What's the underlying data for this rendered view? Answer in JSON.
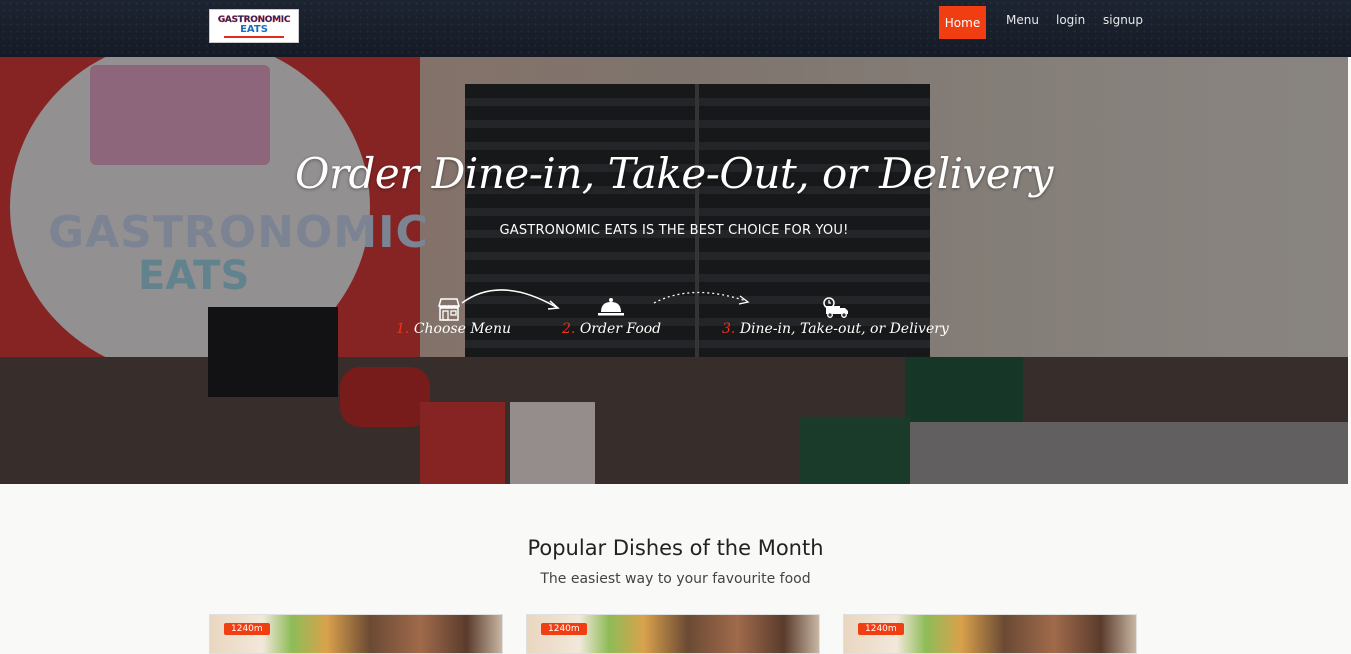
{
  "navbar": {
    "logo": {
      "line1": "GASTRONOMIC",
      "line2": "EATS"
    },
    "links": [
      {
        "label": "Home",
        "active": true
      },
      {
        "label": "Menu"
      },
      {
        "label": "login"
      },
      {
        "label": "signup"
      }
    ],
    "active_color": "#f03d11"
  },
  "hero": {
    "title": "Order Dine-in, Take-Out, or Delivery",
    "subtitle": "GASTRONOMIC EATS IS THE BEST CHOICE FOR YOU!",
    "background_sign": {
      "line1": "GASTRONOMIC",
      "line2": "EATS"
    },
    "steps": [
      {
        "num": "1.",
        "label": "Choose Menu",
        "icon": "store-icon"
      },
      {
        "num": "2.",
        "label": "Order Food",
        "icon": "cloche-icon"
      },
      {
        "num": "3.",
        "label": "Dine-in, Take-out, or Delivery",
        "icon": "delivery-truck-icon"
      }
    ]
  },
  "popular": {
    "title": "Popular Dishes of the Month",
    "subtitle": "The easiest way to your favourite food",
    "cards": [
      {
        "badge": "1240m"
      },
      {
        "badge": "1240m"
      },
      {
        "badge": "1240m"
      }
    ]
  }
}
